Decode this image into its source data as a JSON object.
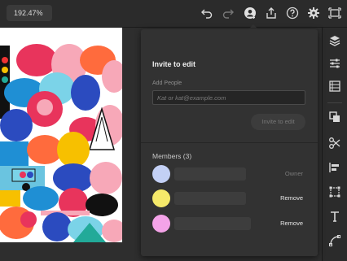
{
  "toolbar": {
    "zoom": "192.47%",
    "icons": [
      "undo-icon",
      "redo-icon",
      "invite-people-icon",
      "share-icon",
      "help-icon",
      "settings-icon",
      "fit-screen-icon"
    ]
  },
  "invite": {
    "title": "Invite to edit",
    "add_people_label": "Add People",
    "email_placeholder": "Kat or kat@example.com",
    "email_value": "",
    "invite_button": "Invite to edit"
  },
  "members": {
    "title": "Members (3)",
    "list": [
      {
        "avatar_color": "#c3d0f5",
        "action": "Owner",
        "action_color": "#7a7a7a"
      },
      {
        "avatar_color": "#f5e96a",
        "action": "Remove",
        "action_color": "#e8e8e8"
      },
      {
        "avatar_color": "#f4a3e8",
        "action": "Remove",
        "action_color": "#e8e8e8"
      }
    ]
  },
  "rail": {
    "icons": [
      "layers-icon",
      "properties-icon",
      "libraries-icon",
      "pathfinder-icon",
      "cut-icon",
      "align-icon",
      "transform-icon",
      "text-icon",
      "pen-icon"
    ]
  },
  "colors": {
    "background": "#1e1e1e",
    "panel": "#323232",
    "topbar": "#2b2b2b"
  }
}
